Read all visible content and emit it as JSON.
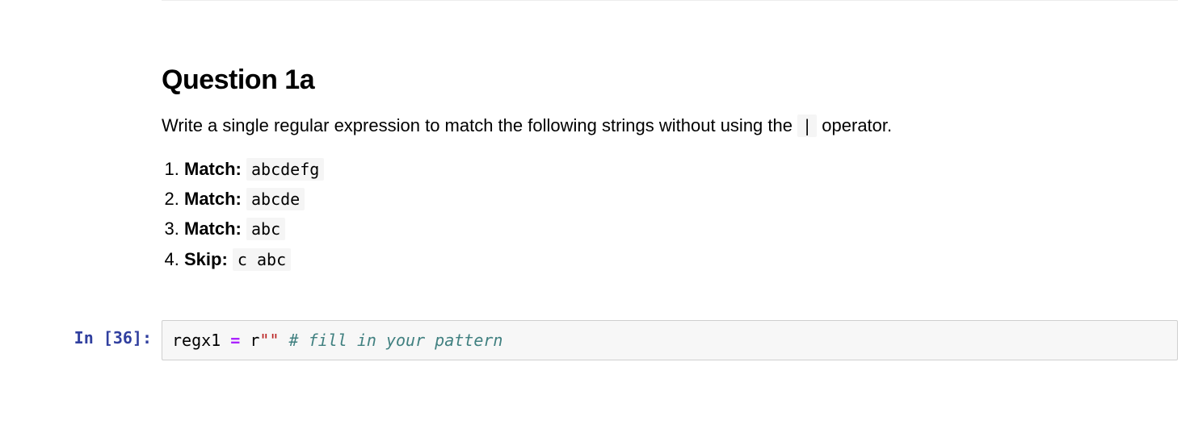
{
  "markdown": {
    "heading": "Question 1a",
    "intro_pre": "Write a single regular expression to match the following strings without using the ",
    "intro_operator": "|",
    "intro_post": " operator.",
    "items": [
      {
        "label": "Match:",
        "code": "abcdefg"
      },
      {
        "label": "Match:",
        "code": "abcde"
      },
      {
        "label": "Match:",
        "code": "abc"
      },
      {
        "label": "Skip:",
        "code": "c abc"
      }
    ]
  },
  "code_cell": {
    "prompt": "In [36]:",
    "tokens": {
      "var": "regx1",
      "assign": "=",
      "str_prefix": "r",
      "string": "\"\"",
      "comment": "# fill in your pattern"
    }
  }
}
